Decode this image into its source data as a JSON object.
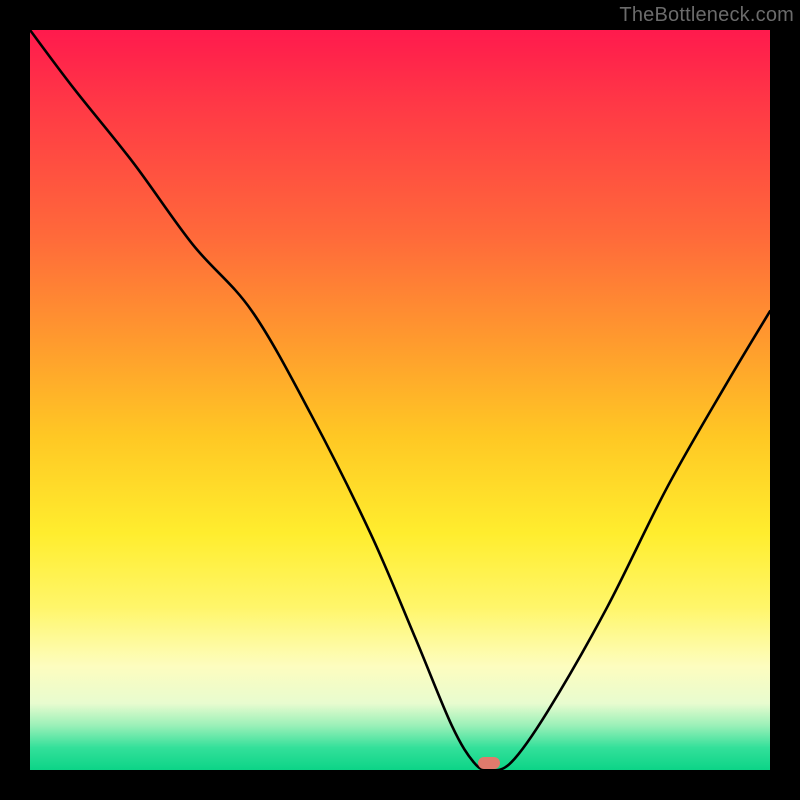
{
  "attribution": "TheBottleneck.com",
  "marker": {
    "x_pct": 62,
    "y_pct": 99
  },
  "chart_data": {
    "type": "line",
    "title": "",
    "xlabel": "",
    "ylabel": "",
    "xlim": [
      0,
      100
    ],
    "ylim": [
      0,
      100
    ],
    "series": [
      {
        "name": "bottleneck-curve",
        "x": [
          0,
          6,
          14,
          22,
          30,
          38,
          46,
          52,
          57,
          60,
          62,
          65,
          70,
          78,
          86,
          94,
          100
        ],
        "y": [
          100,
          92,
          82,
          71,
          62,
          48,
          32,
          18,
          6,
          1,
          0,
          1,
          8,
          22,
          38,
          52,
          62
        ]
      }
    ],
    "annotations": [
      {
        "type": "marker",
        "x": 62,
        "y": 0
      }
    ],
    "background_gradient": {
      "top": "#ff1a4d",
      "bottom": "#0cd487",
      "stops": [
        "red",
        "orange",
        "yellow",
        "pale-yellow",
        "green"
      ]
    }
  }
}
